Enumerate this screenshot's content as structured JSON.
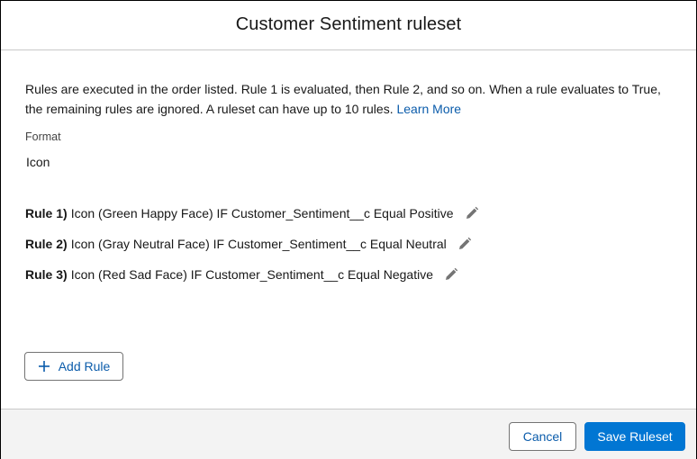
{
  "modal": {
    "title": "Customer Sentiment ruleset"
  },
  "body": {
    "intro_text": "Rules are executed in the order listed. Rule 1 is evaluated, then Rule 2, and so on. When a rule evaluates to True, the remaining rules are ignored. A ruleset can have up to 10 rules. ",
    "learn_more_label": "Learn More",
    "format_label": "Format",
    "format_value": "Icon",
    "rules": [
      {
        "number": "Rule 1)",
        "text": "Icon (Green Happy Face) IF Customer_Sentiment__c Equal Positive",
        "edit_icon": "pencil-icon"
      },
      {
        "number": "Rule 2)",
        "text": "Icon (Gray Neutral Face) IF Customer_Sentiment__c Equal Neutral",
        "edit_icon": "pencil-icon"
      },
      {
        "number": "Rule 3)",
        "text": "Icon (Red Sad Face) IF Customer_Sentiment__c Equal Negative",
        "edit_icon": "pencil-icon"
      }
    ],
    "add_rule_icon": "plus-icon",
    "add_rule_label": "Add Rule"
  },
  "footer": {
    "cancel_label": "Cancel",
    "save_label": "Save Ruleset"
  },
  "colors": {
    "brand": "#0176d3",
    "link": "#0b5cab",
    "text": "#181818",
    "footer_bg": "#f3f3f3",
    "border": "#c9c9c9"
  }
}
